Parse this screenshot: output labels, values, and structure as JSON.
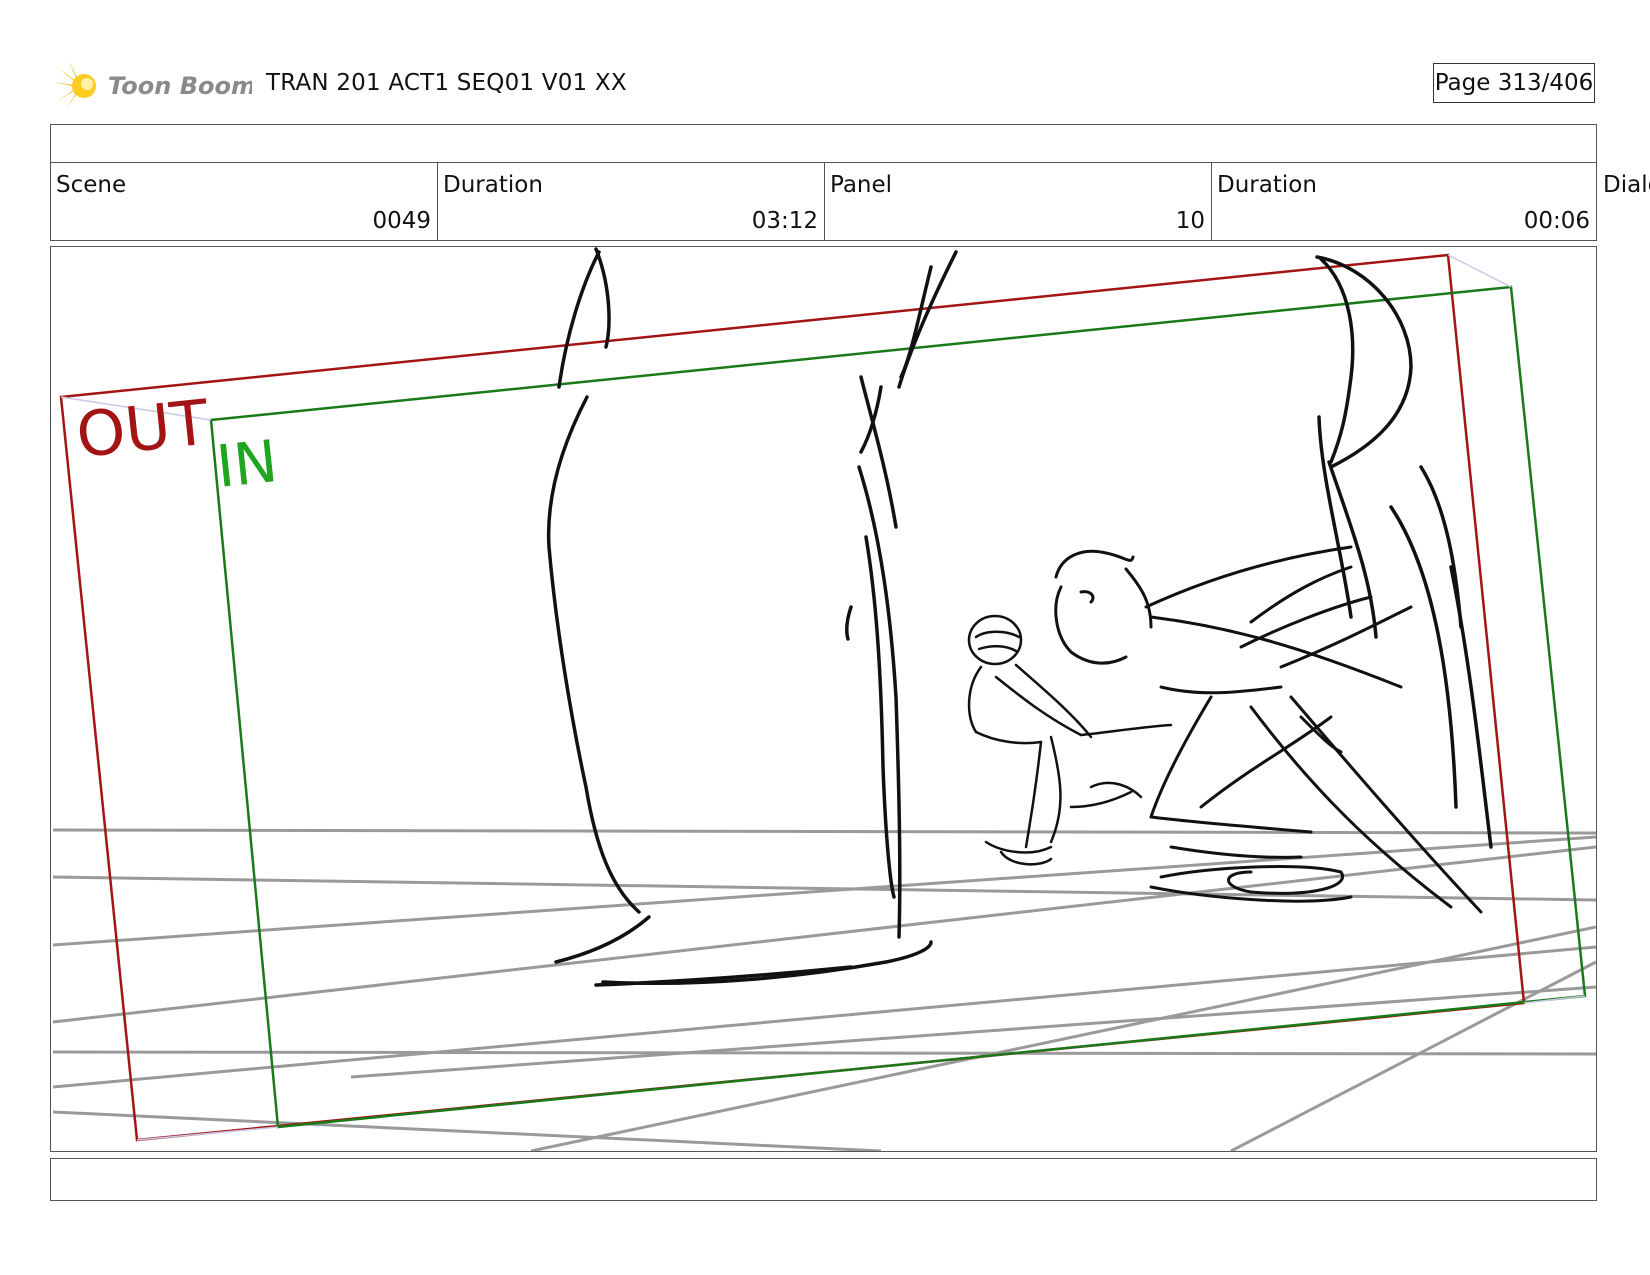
{
  "header": {
    "logo_text": "Toon Boom",
    "title": "TRAN 201 ACT1 SEQ01 V01 XX",
    "page": "Page 313/406"
  },
  "info": {
    "scene_label": "Scene",
    "scene_value": "0049",
    "scene_duration_label": "Duration",
    "scene_duration_value": "03:12",
    "panel_label": "Panel",
    "panel_value": "10",
    "panel_duration_label": "Duration",
    "panel_duration_value": "00:06",
    "cut_label": "Dialo"
  },
  "panel": {
    "out_label": "OUT",
    "in_label": "IN",
    "colors": {
      "out_frame": "#a31515",
      "in_frame": "#1a7a1a",
      "in_text": "#1fa51f",
      "perspective_grid": "#9a9a9a",
      "sketch": "#111111"
    }
  }
}
